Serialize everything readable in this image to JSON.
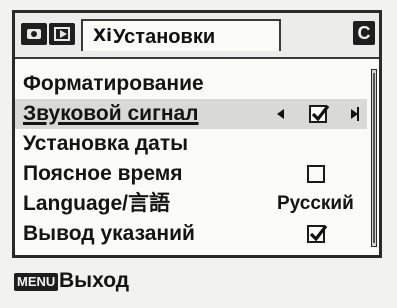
{
  "tabs": {
    "record_icon": "camera-icon",
    "playback_icon": "playback-icon",
    "setup_icon_glyph": "Xi",
    "setup_title": "Установки",
    "custom_label": "C"
  },
  "menu": {
    "items": [
      {
        "label": "Форматирование",
        "value": "",
        "control": "none",
        "selected": false
      },
      {
        "label": "Звуковой сигнал",
        "value": "",
        "control": "checkbox",
        "checked": true,
        "selected": true
      },
      {
        "label": "Установка даты",
        "value": "",
        "control": "none",
        "selected": false
      },
      {
        "label": "Поясное время",
        "value": "",
        "control": "checkbox",
        "checked": false,
        "selected": false
      },
      {
        "label": "Language/言語",
        "value": "Русский",
        "control": "text",
        "selected": false
      },
      {
        "label": "Вывод указаний",
        "value": "",
        "control": "checkbox",
        "checked": true,
        "selected": false
      }
    ]
  },
  "footer": {
    "key_label": "MENU",
    "action_label": "Выход"
  },
  "colors": {
    "background": "#fbfbf8",
    "text": "#141414",
    "highlight": "#d9d9d5",
    "frame": "#2a2a2a"
  }
}
